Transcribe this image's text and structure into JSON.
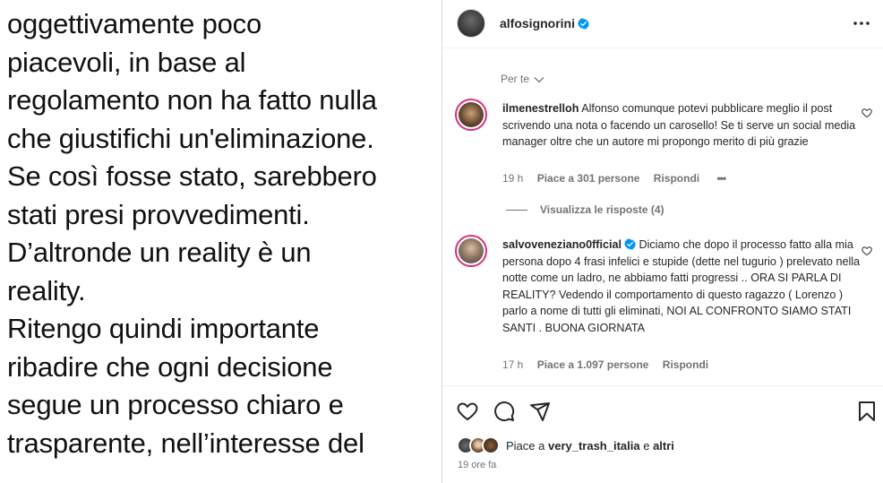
{
  "post_image": {
    "lines": [
      "oggettivamente poco",
      "piacevoli, in base al",
      "regolamento non ha fatto nulla",
      "che giustifichi un'eliminazione.",
      "Se così fosse stato, sarebbero",
      "stati presi provvedimenti.",
      "D’altronde un reality è un",
      "reality.",
      "Ritengo quindi importante",
      "ribadire che ogni decisione",
      "segue un processo chiaro e",
      "trasparente, nell’interesse del"
    ]
  },
  "header": {
    "username": "alfosignorini",
    "verified_icon": "verified-badge-icon",
    "more_icon": "more-horizontal-icon"
  },
  "filter": {
    "label": "Per te",
    "icon": "chevron-down-icon"
  },
  "comments": [
    {
      "username": "ilmenestrelloh",
      "verified": false,
      "text": "Alfonso comunque potevi pubblicare meglio il post scrivendo una nota o facendo un carosello! Se ti serve un social media manager oltre che un autore mi propongo merito di più grazie",
      "time": "19 h",
      "likes": "Piace a 301 persone",
      "reply": "Rispondi",
      "more": "•••",
      "view_replies": "Visualizza le risposte (4)"
    },
    {
      "username": "salvoveneziano0fficial",
      "verified": true,
      "text": "Diciamo che dopo il processo fatto alla mia persona dopo 4 frasi infelici e stupide (dette nel tugurio ) prelevato nella notte come un ladro, ne abbiamo fatti progressi .. ORA SI PARLA DI REALITY? Vedendo il comportamento di questo ragazzo ( Lorenzo ) parlo a nome di tutti gli eliminati, NOI AL CONFRONTO SIAMO STATI SANTI . BUONA GIORNATA",
      "time": "17 h",
      "likes": "Piace a 1.097 persone",
      "reply": "Rispondi"
    }
  ],
  "actions": {
    "like_icon": "heart-icon",
    "comment_icon": "comment-icon",
    "share_icon": "send-icon",
    "save_icon": "bookmark-icon"
  },
  "likes_summary": {
    "prefix": "Piace a ",
    "user": "very_trash_italia",
    "middle": " e ",
    "others": "altri"
  },
  "time_ago": "19 ore fa",
  "colors": {
    "text": "#262626",
    "secondary": "#737373",
    "verified": "#0095f6",
    "story_ring": "#d92e7f"
  }
}
